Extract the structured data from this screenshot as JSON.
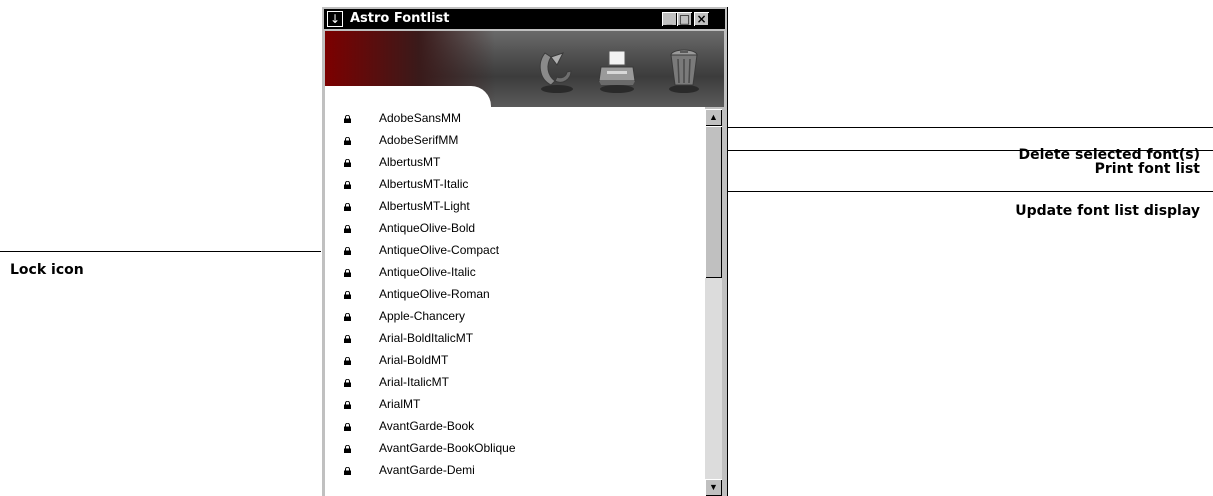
{
  "window": {
    "title": "Astro Fontlist",
    "buttons": {
      "minimize": "_",
      "maximize": "□",
      "close": "×"
    }
  },
  "toolbar": {
    "tools": [
      {
        "name": "update-font-list-display",
        "icon": "refresh-arrow-icon"
      },
      {
        "name": "print-font-list",
        "icon": "printer-icon"
      },
      {
        "name": "delete-selected-fonts",
        "icon": "trash-can-icon"
      }
    ]
  },
  "fonts": [
    "AdobeSansMM",
    "AdobeSerifMM",
    "AlbertusMT",
    "AlbertusMT-Italic",
    "AlbertusMT-Light",
    "AntiqueOlive-Bold",
    "AntiqueOlive-Compact",
    "AntiqueOlive-Italic",
    "AntiqueOlive-Roman",
    "Apple-Chancery",
    "Arial-BoldItalicMT",
    "Arial-BoldMT",
    "Arial-ItalicMT",
    "ArialMT",
    "AvantGarde-Book",
    "AvantGarde-BookOblique",
    "AvantGarde-Demi"
  ],
  "callouts": {
    "delete": "Delete selected font(s)",
    "print": "Print font list",
    "update": "Update font list display",
    "lock": "Lock icon"
  },
  "colors": {
    "titlebar": "#000000",
    "toolbar_accent": "#7c0000",
    "window_face": "#c0c0c0"
  }
}
